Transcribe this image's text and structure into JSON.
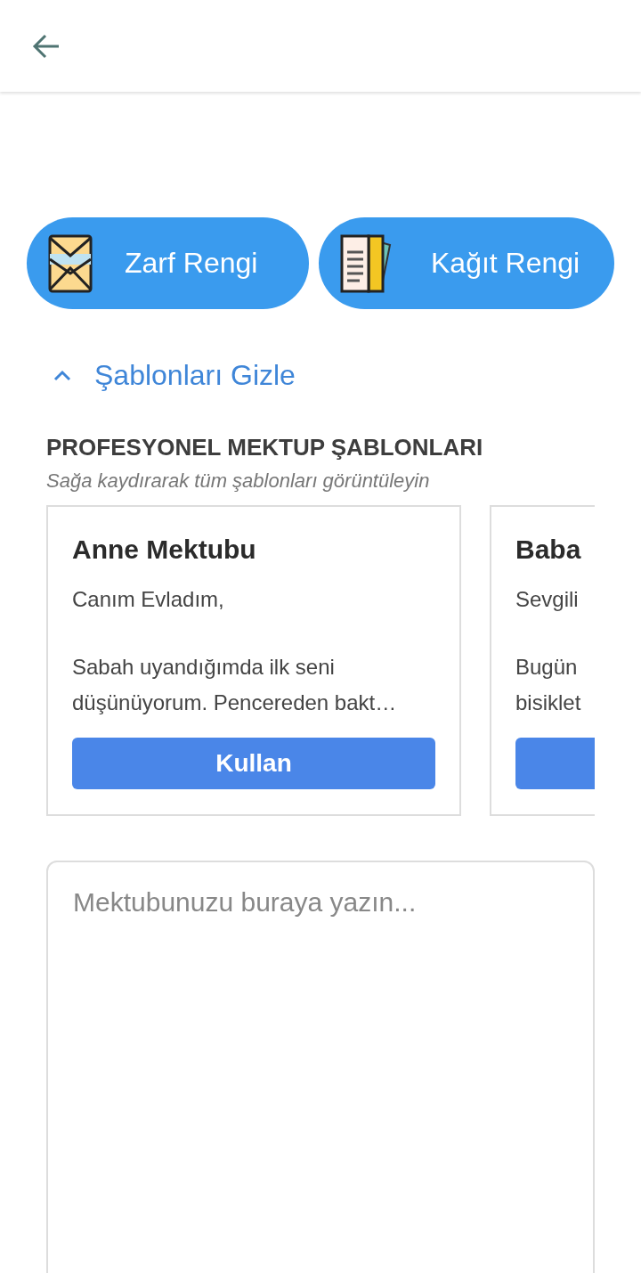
{
  "color_buttons": [
    {
      "kind": "envelope",
      "label": "Zarf Rengi"
    },
    {
      "kind": "paper",
      "label": "Kağıt Rengi"
    }
  ],
  "templates_toggle": {
    "label": "Şablonları Gizle",
    "expanded": true
  },
  "templates": {
    "title": "PROFESYONEL MEKTUP ŞABLONLARI",
    "hint": "Sağa kaydırarak tüm şablonları görüntüleyin",
    "cards": [
      {
        "title": "Anne Mektubu",
        "greeting": "Canım Evladım,",
        "lines": [
          "Sabah uyandığımda ilk seni",
          "düşünüyorum. Pencereden bakt…"
        ],
        "button": "Kullan"
      },
      {
        "title": "Baba",
        "greeting": "Sevgili",
        "lines": [
          "Bugün",
          "bisiklet"
        ]
      }
    ]
  },
  "letter": {
    "placeholder": "Mektubunuzu buraya yazın..."
  }
}
